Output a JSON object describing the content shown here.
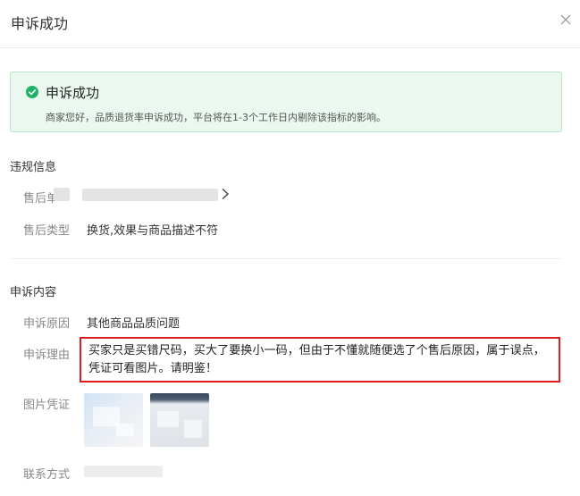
{
  "dialog": {
    "title": "申诉成功",
    "close_icon": "close-icon"
  },
  "success": {
    "icon": "check-circle-icon",
    "title": "申诉成功",
    "description": "商家您好，品质退货率申诉成功，平台将在1-3个工作日内剔除该指标的影响。",
    "colors": {
      "background": "#eaf8ef",
      "border": "#b9e6c9",
      "icon": "#20b266"
    }
  },
  "violation": {
    "section_title": "违规信息",
    "after_sale_no_label": "售后单",
    "after_sale_type_label": "售后类型",
    "after_sale_type_value": "换货,效果与商品描述不符"
  },
  "appeal": {
    "section_title": "申诉内容",
    "reason_label": "申诉原因",
    "reason_value": "其他商品品质问题",
    "explanation_label": "申诉理由",
    "explanation_value": "买家只是买错尺码，买大了要换小一码，但由于不懂就随便选了个售后原因，属于误点，凭证可看图片。请明鉴！",
    "evidence_label": "图片凭证",
    "contact_label": "联系方式",
    "highlight_color": "#e11b1b"
  }
}
